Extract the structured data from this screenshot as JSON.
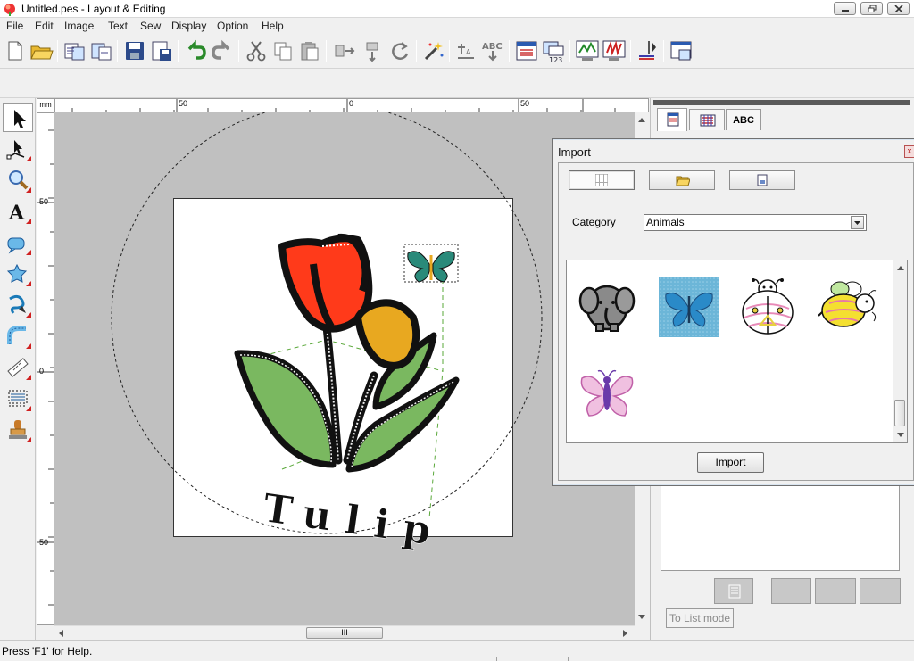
{
  "window": {
    "title": "Untitled.pes - Layout & Editing"
  },
  "menu": [
    "File",
    "Edit",
    "Image",
    "Text",
    "Sew",
    "Display",
    "Option",
    "Help"
  ],
  "ruler": {
    "unit": "mm",
    "h_labels": [
      "50",
      "0",
      "50"
    ],
    "v_labels": [
      "50",
      "0",
      "50"
    ]
  },
  "design": {
    "text": "Tulip"
  },
  "right_panel": {
    "tab_text_label": "ABC",
    "to_list_button": "To List mode"
  },
  "import_dialog": {
    "title": "Import",
    "close": "x",
    "category_label": "Category",
    "category_value": "Animals",
    "thumbnails": [
      "elephant-design",
      "blue-butterfly-design",
      "ladybug-design",
      "bee-design",
      "pink-butterfly-design"
    ],
    "selected_thumbnail": "blue-butterfly-design",
    "import_button": "Import"
  },
  "status": {
    "text": "Press 'F1' for Help."
  },
  "hscroll_grip": "III",
  "colors": {
    "tulip_red": "#ff3a1a",
    "tulip_yellow": "#e8a820",
    "leaf_green": "#7ab860",
    "selection_blue": "#6cb6d8"
  }
}
